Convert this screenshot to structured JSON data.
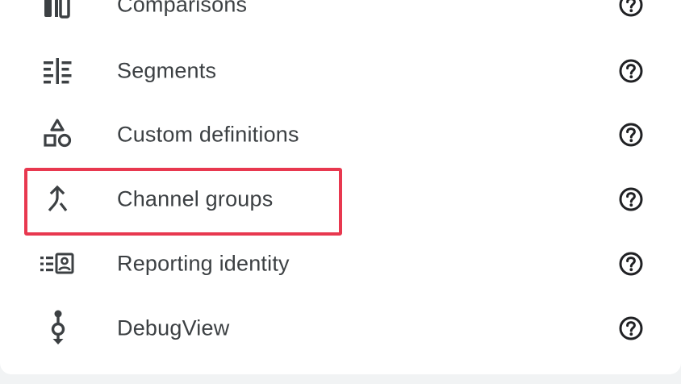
{
  "menu": {
    "items": [
      {
        "label": "Comparisons",
        "icon": "comparisons-icon"
      },
      {
        "label": "Segments",
        "icon": "segments-icon"
      },
      {
        "label": "Custom definitions",
        "icon": "shapes-icon"
      },
      {
        "label": "Channel groups",
        "icon": "merge-icon"
      },
      {
        "label": "Reporting identity",
        "icon": "identity-icon"
      },
      {
        "label": "DebugView",
        "icon": "debug-icon"
      }
    ],
    "help_icon": "help-circle-icon",
    "highlighted_item": "Channel groups"
  },
  "colors": {
    "text": "#3c4043",
    "icon": "#3c4043",
    "highlight": "#e8384f",
    "background": "#ffffff"
  }
}
